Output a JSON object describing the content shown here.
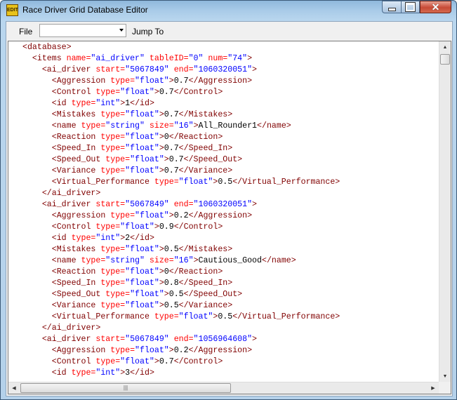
{
  "window": {
    "title": "Race Driver Grid Database Editor",
    "icon_text": "EDIT"
  },
  "menu": {
    "file": "File",
    "selector_value": "",
    "jump_to": "Jump To"
  },
  "colors": {
    "tag": "#800000",
    "attr": "#ff0000",
    "value": "#0000ff",
    "text": "#000000"
  },
  "editor": {
    "lines": [
      {
        "indent": 0,
        "parts": [
          {
            "c": "t",
            "s": "<database>"
          }
        ]
      },
      {
        "indent": 1,
        "parts": [
          {
            "c": "t",
            "s": "<items "
          },
          {
            "c": "a",
            "s": "name="
          },
          {
            "c": "v",
            "s": "\"ai_driver\""
          },
          {
            "c": "a",
            "s": " tableID="
          },
          {
            "c": "v",
            "s": "\"0\""
          },
          {
            "c": "a",
            "s": " num="
          },
          {
            "c": "v",
            "s": "\"74\""
          },
          {
            "c": "t",
            "s": ">"
          }
        ]
      },
      {
        "indent": 2,
        "parts": [
          {
            "c": "t",
            "s": "<ai_driver "
          },
          {
            "c": "a",
            "s": "start="
          },
          {
            "c": "v",
            "s": "\"5067849\""
          },
          {
            "c": "a",
            "s": " end="
          },
          {
            "c": "v",
            "s": "\"1060320051\""
          },
          {
            "c": "t",
            "s": ">"
          }
        ]
      },
      {
        "indent": 3,
        "parts": [
          {
            "c": "t",
            "s": "<Aggression "
          },
          {
            "c": "a",
            "s": "type="
          },
          {
            "c": "v",
            "s": "\"float\""
          },
          {
            "c": "t",
            "s": ">"
          },
          {
            "c": "x",
            "s": "0.7"
          },
          {
            "c": "t",
            "s": "</Aggression>"
          }
        ]
      },
      {
        "indent": 3,
        "parts": [
          {
            "c": "t",
            "s": "<Control "
          },
          {
            "c": "a",
            "s": "type="
          },
          {
            "c": "v",
            "s": "\"float\""
          },
          {
            "c": "t",
            "s": ">"
          },
          {
            "c": "x",
            "s": "0.7"
          },
          {
            "c": "t",
            "s": "</Control>"
          }
        ]
      },
      {
        "indent": 3,
        "parts": [
          {
            "c": "t",
            "s": "<id "
          },
          {
            "c": "a",
            "s": "type="
          },
          {
            "c": "v",
            "s": "\"int\""
          },
          {
            "c": "t",
            "s": ">"
          },
          {
            "c": "x",
            "s": "1"
          },
          {
            "c": "t",
            "s": "</id>"
          }
        ]
      },
      {
        "indent": 3,
        "parts": [
          {
            "c": "t",
            "s": "<Mistakes "
          },
          {
            "c": "a",
            "s": "type="
          },
          {
            "c": "v",
            "s": "\"float\""
          },
          {
            "c": "t",
            "s": ">"
          },
          {
            "c": "x",
            "s": "0.7"
          },
          {
            "c": "t",
            "s": "</Mistakes>"
          }
        ]
      },
      {
        "indent": 3,
        "parts": [
          {
            "c": "t",
            "s": "<name "
          },
          {
            "c": "a",
            "s": "type="
          },
          {
            "c": "v",
            "s": "\"string\""
          },
          {
            "c": "a",
            "s": " size="
          },
          {
            "c": "v",
            "s": "\"16\""
          },
          {
            "c": "t",
            "s": ">"
          },
          {
            "c": "x",
            "s": "All_Rounder1"
          },
          {
            "c": "t",
            "s": "</name>"
          }
        ]
      },
      {
        "indent": 3,
        "parts": [
          {
            "c": "t",
            "s": "<Reaction "
          },
          {
            "c": "a",
            "s": "type="
          },
          {
            "c": "v",
            "s": "\"float\""
          },
          {
            "c": "t",
            "s": ">"
          },
          {
            "c": "x",
            "s": "0"
          },
          {
            "c": "t",
            "s": "</Reaction>"
          }
        ]
      },
      {
        "indent": 3,
        "parts": [
          {
            "c": "t",
            "s": "<Speed_In "
          },
          {
            "c": "a",
            "s": "type="
          },
          {
            "c": "v",
            "s": "\"float\""
          },
          {
            "c": "t",
            "s": ">"
          },
          {
            "c": "x",
            "s": "0.7"
          },
          {
            "c": "t",
            "s": "</Speed_In>"
          }
        ]
      },
      {
        "indent": 3,
        "parts": [
          {
            "c": "t",
            "s": "<Speed_Out "
          },
          {
            "c": "a",
            "s": "type="
          },
          {
            "c": "v",
            "s": "\"float\""
          },
          {
            "c": "t",
            "s": ">"
          },
          {
            "c": "x",
            "s": "0.7"
          },
          {
            "c": "t",
            "s": "</Speed_Out>"
          }
        ]
      },
      {
        "indent": 3,
        "parts": [
          {
            "c": "t",
            "s": "<Variance "
          },
          {
            "c": "a",
            "s": "type="
          },
          {
            "c": "v",
            "s": "\"float\""
          },
          {
            "c": "t",
            "s": ">"
          },
          {
            "c": "x",
            "s": "0.7"
          },
          {
            "c": "t",
            "s": "</Variance>"
          }
        ]
      },
      {
        "indent": 3,
        "parts": [
          {
            "c": "t",
            "s": "<Virtual_Performance "
          },
          {
            "c": "a",
            "s": "type="
          },
          {
            "c": "v",
            "s": "\"float\""
          },
          {
            "c": "t",
            "s": ">"
          },
          {
            "c": "x",
            "s": "0.5"
          },
          {
            "c": "t",
            "s": "</Virtual_Performance>"
          }
        ]
      },
      {
        "indent": 2,
        "parts": [
          {
            "c": "t",
            "s": "</ai_driver>"
          }
        ]
      },
      {
        "indent": 2,
        "parts": [
          {
            "c": "t",
            "s": "<ai_driver "
          },
          {
            "c": "a",
            "s": "start="
          },
          {
            "c": "v",
            "s": "\"5067849\""
          },
          {
            "c": "a",
            "s": " end="
          },
          {
            "c": "v",
            "s": "\"1060320051\""
          },
          {
            "c": "t",
            "s": ">"
          }
        ]
      },
      {
        "indent": 3,
        "parts": [
          {
            "c": "t",
            "s": "<Aggression "
          },
          {
            "c": "a",
            "s": "type="
          },
          {
            "c": "v",
            "s": "\"float\""
          },
          {
            "c": "t",
            "s": ">"
          },
          {
            "c": "x",
            "s": "0.2"
          },
          {
            "c": "t",
            "s": "</Aggression>"
          }
        ]
      },
      {
        "indent": 3,
        "parts": [
          {
            "c": "t",
            "s": "<Control "
          },
          {
            "c": "a",
            "s": "type="
          },
          {
            "c": "v",
            "s": "\"float\""
          },
          {
            "c": "t",
            "s": ">"
          },
          {
            "c": "x",
            "s": "0.9"
          },
          {
            "c": "t",
            "s": "</Control>"
          }
        ]
      },
      {
        "indent": 3,
        "parts": [
          {
            "c": "t",
            "s": "<id "
          },
          {
            "c": "a",
            "s": "type="
          },
          {
            "c": "v",
            "s": "\"int\""
          },
          {
            "c": "t",
            "s": ">"
          },
          {
            "c": "x",
            "s": "2"
          },
          {
            "c": "t",
            "s": "</id>"
          }
        ]
      },
      {
        "indent": 3,
        "parts": [
          {
            "c": "t",
            "s": "<Mistakes "
          },
          {
            "c": "a",
            "s": "type="
          },
          {
            "c": "v",
            "s": "\"float\""
          },
          {
            "c": "t",
            "s": ">"
          },
          {
            "c": "x",
            "s": "0.5"
          },
          {
            "c": "t",
            "s": "</Mistakes>"
          }
        ]
      },
      {
        "indent": 3,
        "parts": [
          {
            "c": "t",
            "s": "<name "
          },
          {
            "c": "a",
            "s": "type="
          },
          {
            "c": "v",
            "s": "\"string\""
          },
          {
            "c": "a",
            "s": " size="
          },
          {
            "c": "v",
            "s": "\"16\""
          },
          {
            "c": "t",
            "s": ">"
          },
          {
            "c": "x",
            "s": "Cautious_Good"
          },
          {
            "c": "t",
            "s": "</name>"
          }
        ]
      },
      {
        "indent": 3,
        "parts": [
          {
            "c": "t",
            "s": "<Reaction "
          },
          {
            "c": "a",
            "s": "type="
          },
          {
            "c": "v",
            "s": "\"float\""
          },
          {
            "c": "t",
            "s": ">"
          },
          {
            "c": "x",
            "s": "0"
          },
          {
            "c": "t",
            "s": "</Reaction>"
          }
        ]
      },
      {
        "indent": 3,
        "parts": [
          {
            "c": "t",
            "s": "<Speed_In "
          },
          {
            "c": "a",
            "s": "type="
          },
          {
            "c": "v",
            "s": "\"float\""
          },
          {
            "c": "t",
            "s": ">"
          },
          {
            "c": "x",
            "s": "0.8"
          },
          {
            "c": "t",
            "s": "</Speed_In>"
          }
        ]
      },
      {
        "indent": 3,
        "parts": [
          {
            "c": "t",
            "s": "<Speed_Out "
          },
          {
            "c": "a",
            "s": "type="
          },
          {
            "c": "v",
            "s": "\"float\""
          },
          {
            "c": "t",
            "s": ">"
          },
          {
            "c": "x",
            "s": "0.5"
          },
          {
            "c": "t",
            "s": "</Speed_Out>"
          }
        ]
      },
      {
        "indent": 3,
        "parts": [
          {
            "c": "t",
            "s": "<Variance "
          },
          {
            "c": "a",
            "s": "type="
          },
          {
            "c": "v",
            "s": "\"float\""
          },
          {
            "c": "t",
            "s": ">"
          },
          {
            "c": "x",
            "s": "0.5"
          },
          {
            "c": "t",
            "s": "</Variance>"
          }
        ]
      },
      {
        "indent": 3,
        "parts": [
          {
            "c": "t",
            "s": "<Virtual_Performance "
          },
          {
            "c": "a",
            "s": "type="
          },
          {
            "c": "v",
            "s": "\"float\""
          },
          {
            "c": "t",
            "s": ">"
          },
          {
            "c": "x",
            "s": "0.5"
          },
          {
            "c": "t",
            "s": "</Virtual_Performance>"
          }
        ]
      },
      {
        "indent": 2,
        "parts": [
          {
            "c": "t",
            "s": "</ai_driver>"
          }
        ]
      },
      {
        "indent": 2,
        "parts": [
          {
            "c": "t",
            "s": "<ai_driver "
          },
          {
            "c": "a",
            "s": "start="
          },
          {
            "c": "v",
            "s": "\"5067849\""
          },
          {
            "c": "a",
            "s": " end="
          },
          {
            "c": "v",
            "s": "\"1056964608\""
          },
          {
            "c": "t",
            "s": ">"
          }
        ]
      },
      {
        "indent": 3,
        "parts": [
          {
            "c": "t",
            "s": "<Aggression "
          },
          {
            "c": "a",
            "s": "type="
          },
          {
            "c": "v",
            "s": "\"float\""
          },
          {
            "c": "t",
            "s": ">"
          },
          {
            "c": "x",
            "s": "0.2"
          },
          {
            "c": "t",
            "s": "</Aggression>"
          }
        ]
      },
      {
        "indent": 3,
        "parts": [
          {
            "c": "t",
            "s": "<Control "
          },
          {
            "c": "a",
            "s": "type="
          },
          {
            "c": "v",
            "s": "\"float\""
          },
          {
            "c": "t",
            "s": ">"
          },
          {
            "c": "x",
            "s": "0.7"
          },
          {
            "c": "t",
            "s": "</Control>"
          }
        ]
      },
      {
        "indent": 3,
        "parts": [
          {
            "c": "t",
            "s": "<id "
          },
          {
            "c": "a",
            "s": "type="
          },
          {
            "c": "v",
            "s": "\"int\""
          },
          {
            "c": "t",
            "s": ">"
          },
          {
            "c": "x",
            "s": "3"
          },
          {
            "c": "t",
            "s": "</id>"
          }
        ]
      }
    ]
  }
}
